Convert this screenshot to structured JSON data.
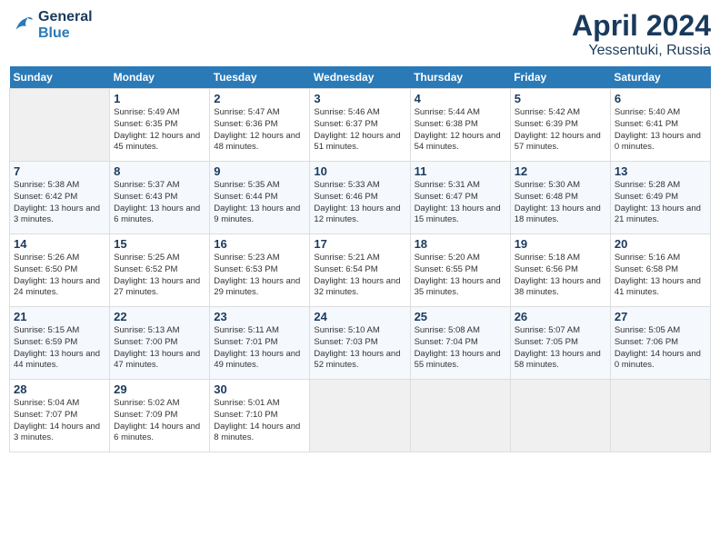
{
  "logo": {
    "line1": "General",
    "line2": "Blue"
  },
  "title": "April 2024",
  "location": "Yessentuki, Russia",
  "days_header": [
    "Sunday",
    "Monday",
    "Tuesday",
    "Wednesday",
    "Thursday",
    "Friday",
    "Saturday"
  ],
  "weeks": [
    [
      {
        "day": "",
        "sunrise": "",
        "sunset": "",
        "daylight": ""
      },
      {
        "day": "1",
        "sunrise": "Sunrise: 5:49 AM",
        "sunset": "Sunset: 6:35 PM",
        "daylight": "Daylight: 12 hours and 45 minutes."
      },
      {
        "day": "2",
        "sunrise": "Sunrise: 5:47 AM",
        "sunset": "Sunset: 6:36 PM",
        "daylight": "Daylight: 12 hours and 48 minutes."
      },
      {
        "day": "3",
        "sunrise": "Sunrise: 5:46 AM",
        "sunset": "Sunset: 6:37 PM",
        "daylight": "Daylight: 12 hours and 51 minutes."
      },
      {
        "day": "4",
        "sunrise": "Sunrise: 5:44 AM",
        "sunset": "Sunset: 6:38 PM",
        "daylight": "Daylight: 12 hours and 54 minutes."
      },
      {
        "day": "5",
        "sunrise": "Sunrise: 5:42 AM",
        "sunset": "Sunset: 6:39 PM",
        "daylight": "Daylight: 12 hours and 57 minutes."
      },
      {
        "day": "6",
        "sunrise": "Sunrise: 5:40 AM",
        "sunset": "Sunset: 6:41 PM",
        "daylight": "Daylight: 13 hours and 0 minutes."
      }
    ],
    [
      {
        "day": "7",
        "sunrise": "Sunrise: 5:38 AM",
        "sunset": "Sunset: 6:42 PM",
        "daylight": "Daylight: 13 hours and 3 minutes."
      },
      {
        "day": "8",
        "sunrise": "Sunrise: 5:37 AM",
        "sunset": "Sunset: 6:43 PM",
        "daylight": "Daylight: 13 hours and 6 minutes."
      },
      {
        "day": "9",
        "sunrise": "Sunrise: 5:35 AM",
        "sunset": "Sunset: 6:44 PM",
        "daylight": "Daylight: 13 hours and 9 minutes."
      },
      {
        "day": "10",
        "sunrise": "Sunrise: 5:33 AM",
        "sunset": "Sunset: 6:46 PM",
        "daylight": "Daylight: 13 hours and 12 minutes."
      },
      {
        "day": "11",
        "sunrise": "Sunrise: 5:31 AM",
        "sunset": "Sunset: 6:47 PM",
        "daylight": "Daylight: 13 hours and 15 minutes."
      },
      {
        "day": "12",
        "sunrise": "Sunrise: 5:30 AM",
        "sunset": "Sunset: 6:48 PM",
        "daylight": "Daylight: 13 hours and 18 minutes."
      },
      {
        "day": "13",
        "sunrise": "Sunrise: 5:28 AM",
        "sunset": "Sunset: 6:49 PM",
        "daylight": "Daylight: 13 hours and 21 minutes."
      }
    ],
    [
      {
        "day": "14",
        "sunrise": "Sunrise: 5:26 AM",
        "sunset": "Sunset: 6:50 PM",
        "daylight": "Daylight: 13 hours and 24 minutes."
      },
      {
        "day": "15",
        "sunrise": "Sunrise: 5:25 AM",
        "sunset": "Sunset: 6:52 PM",
        "daylight": "Daylight: 13 hours and 27 minutes."
      },
      {
        "day": "16",
        "sunrise": "Sunrise: 5:23 AM",
        "sunset": "Sunset: 6:53 PM",
        "daylight": "Daylight: 13 hours and 29 minutes."
      },
      {
        "day": "17",
        "sunrise": "Sunrise: 5:21 AM",
        "sunset": "Sunset: 6:54 PM",
        "daylight": "Daylight: 13 hours and 32 minutes."
      },
      {
        "day": "18",
        "sunrise": "Sunrise: 5:20 AM",
        "sunset": "Sunset: 6:55 PM",
        "daylight": "Daylight: 13 hours and 35 minutes."
      },
      {
        "day": "19",
        "sunrise": "Sunrise: 5:18 AM",
        "sunset": "Sunset: 6:56 PM",
        "daylight": "Daylight: 13 hours and 38 minutes."
      },
      {
        "day": "20",
        "sunrise": "Sunrise: 5:16 AM",
        "sunset": "Sunset: 6:58 PM",
        "daylight": "Daylight: 13 hours and 41 minutes."
      }
    ],
    [
      {
        "day": "21",
        "sunrise": "Sunrise: 5:15 AM",
        "sunset": "Sunset: 6:59 PM",
        "daylight": "Daylight: 13 hours and 44 minutes."
      },
      {
        "day": "22",
        "sunrise": "Sunrise: 5:13 AM",
        "sunset": "Sunset: 7:00 PM",
        "daylight": "Daylight: 13 hours and 47 minutes."
      },
      {
        "day": "23",
        "sunrise": "Sunrise: 5:11 AM",
        "sunset": "Sunset: 7:01 PM",
        "daylight": "Daylight: 13 hours and 49 minutes."
      },
      {
        "day": "24",
        "sunrise": "Sunrise: 5:10 AM",
        "sunset": "Sunset: 7:03 PM",
        "daylight": "Daylight: 13 hours and 52 minutes."
      },
      {
        "day": "25",
        "sunrise": "Sunrise: 5:08 AM",
        "sunset": "Sunset: 7:04 PM",
        "daylight": "Daylight: 13 hours and 55 minutes."
      },
      {
        "day": "26",
        "sunrise": "Sunrise: 5:07 AM",
        "sunset": "Sunset: 7:05 PM",
        "daylight": "Daylight: 13 hours and 58 minutes."
      },
      {
        "day": "27",
        "sunrise": "Sunrise: 5:05 AM",
        "sunset": "Sunset: 7:06 PM",
        "daylight": "Daylight: 14 hours and 0 minutes."
      }
    ],
    [
      {
        "day": "28",
        "sunrise": "Sunrise: 5:04 AM",
        "sunset": "Sunset: 7:07 PM",
        "daylight": "Daylight: 14 hours and 3 minutes."
      },
      {
        "day": "29",
        "sunrise": "Sunrise: 5:02 AM",
        "sunset": "Sunset: 7:09 PM",
        "daylight": "Daylight: 14 hours and 6 minutes."
      },
      {
        "day": "30",
        "sunrise": "Sunrise: 5:01 AM",
        "sunset": "Sunset: 7:10 PM",
        "daylight": "Daylight: 14 hours and 8 minutes."
      },
      {
        "day": "",
        "sunrise": "",
        "sunset": "",
        "daylight": ""
      },
      {
        "day": "",
        "sunrise": "",
        "sunset": "",
        "daylight": ""
      },
      {
        "day": "",
        "sunrise": "",
        "sunset": "",
        "daylight": ""
      },
      {
        "day": "",
        "sunrise": "",
        "sunset": "",
        "daylight": ""
      }
    ]
  ]
}
